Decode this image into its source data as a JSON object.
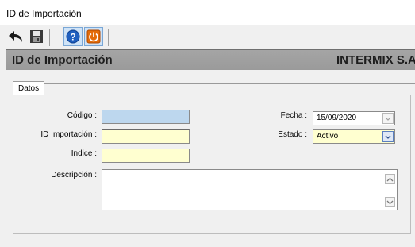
{
  "window": {
    "title": "ID de Importación"
  },
  "toolbar": {
    "buttons": [
      {
        "name": "back-button",
        "icon": "back-arrow-icon"
      },
      {
        "name": "save-button",
        "icon": "floppy-disk-icon"
      },
      {
        "name": "help-button",
        "icon": "help-question-icon"
      },
      {
        "name": "power-button",
        "icon": "power-icon"
      }
    ]
  },
  "header": {
    "title": "ID de Importación",
    "company": "INTERMIX S.A"
  },
  "tabs": [
    {
      "label": "Datos"
    }
  ],
  "form": {
    "codigo": {
      "label": "Código :",
      "value": ""
    },
    "id_importacion": {
      "label": "ID Importación :",
      "value": ""
    },
    "indice": {
      "label": "Indice :",
      "value": ""
    },
    "descripcion": {
      "label": "Descripción :",
      "value": ""
    },
    "fecha": {
      "label": "Fecha :",
      "value": "15/09/2020"
    },
    "estado": {
      "label": "Estado :",
      "value": "Activo"
    }
  },
  "colors": {
    "header_bg": "#9e9e9e",
    "codigo_field": "#bdd7ee",
    "yellow_field": "#ffffd0",
    "power_button": "#e46c0a",
    "help_button": "#1f5fbf"
  }
}
